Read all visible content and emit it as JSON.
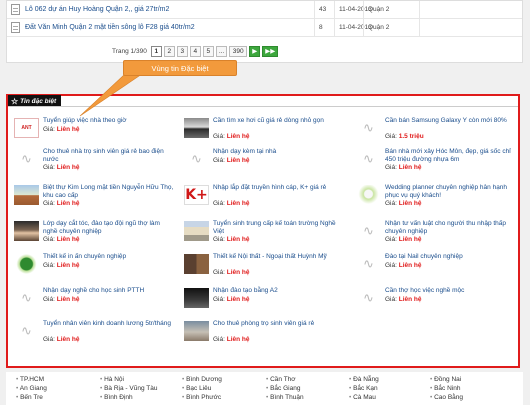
{
  "listing": {
    "rows": [
      {
        "title": "Lô 062 dự án Huy Hoàng Quận 2,, giá 27tr/m2",
        "c1": "43",
        "c2": "11-04-2013",
        "c3": "Quận 2",
        "c4": ""
      },
      {
        "title": "Đất Văn Minh Quận 2 mặt tiền sông lô F28 giá 40tr/m2",
        "c1": "8",
        "c2": "11-04-2013",
        "c3": "Quận 2",
        "c4": ""
      }
    ],
    "pager": {
      "info": "Trang 1/390",
      "pages": [
        "1",
        "2",
        "3",
        "4",
        "5",
        "...",
        "390"
      ],
      "next": "▶",
      "last": "▶▶"
    }
  },
  "callout": {
    "label": "Vùng tin Đặc biệt"
  },
  "special": {
    "tag_label": "Tin đặc biệt",
    "price_prefix": "Giá: ",
    "items": [
      {
        "title": "Tuyển giúp việc nhà theo giờ",
        "price": "Liên hệ",
        "thumb": "logo",
        "thumb_text": "ANT"
      },
      {
        "title": "Cần tìm xe hơi cũ giá rẻ dòng nhỏ gọn",
        "price": "Liên hệ",
        "thumb": "car"
      },
      {
        "title": "Cần bán Samsung Galaxy Y còn mới 80%",
        "price": "1.5 triệu",
        "thumb": "na"
      },
      {
        "title": "Cho thuê nhà trọ sinh viên giá rẻ bao điện nước",
        "price": "Liên hệ",
        "thumb": "na"
      },
      {
        "title": "Nhận dạy kèm tại nhà",
        "price": "Liên hệ",
        "thumb": "na"
      },
      {
        "title": "Bán nhà mới xây Hóc Môn, đẹp, giá sốc chỉ 450 triệu đường nhựa 6m",
        "price": "Liên hệ",
        "thumb": "na"
      },
      {
        "title": "Biệt thự Kim Long mặt tiền Nguyễn Hữu Thọ, khu cao cấp",
        "price": "Liên hệ",
        "thumb": "house"
      },
      {
        "title": "Nhập lắp đặt truyền hình cáp, K+ giá rẻ",
        "price": "Liên hệ",
        "thumb": "k",
        "thumb_text": "K+"
      },
      {
        "title": "Wedding planner chuyên nghiệp hân hạnh phục vụ quý khách!",
        "price": "Liên hệ",
        "thumb": "flower"
      },
      {
        "title": "Lớp dạy cắt tóc, đào tạo đội ngũ thợ làm nghề chuyên nghiệp",
        "price": "Liên hệ",
        "thumb": "girl"
      },
      {
        "title": "Tuyển sinh trung cấp kế toán trường Nghề Việt",
        "price": "Liên hệ",
        "thumb": "building"
      },
      {
        "title": "Nhận tư vấn luật cho người thu nhập thấp chuyên nghiệp",
        "price": "Liên hệ",
        "thumb": "na"
      },
      {
        "title": "Thiết kế in ấn chuyên nghiệp",
        "price": "Liên hệ",
        "thumb": "tree"
      },
      {
        "title": "Thiết kế Nội thất - Ngoại thất Huỳnh Mỹ",
        "price": "Liên hệ",
        "thumb": "cab"
      },
      {
        "title": "Đào tại Nail chuyên nghiệp",
        "price": "Liên hệ",
        "thumb": "na"
      },
      {
        "title": "Nhận dạy nghề cho học sinh PTTH",
        "price": "Liên hệ",
        "thumb": "na"
      },
      {
        "title": "Nhận đào tạo bằng A2",
        "price": "Liên hệ",
        "thumb": "dark"
      },
      {
        "title": "Cần thợ học việc nghề mộc",
        "price": "Liên hệ",
        "thumb": "na"
      },
      {
        "title": "Tuyển nhân viên kinh doanh lương 5tr/tháng",
        "price": "Liên hệ",
        "thumb": "na"
      },
      {
        "title": "Cho thuê phòng trọ sinh viên giá rẻ",
        "price": "Liên hệ",
        "thumb": "room"
      }
    ]
  },
  "footer": {
    "links": [
      "TP.HCM",
      "Hà Nội",
      "Bình Dương",
      "Cần Thơ",
      "Đà Nẵng",
      "Đồng Nai",
      "An Giang",
      "Bà Rịa - Vũng Tàu",
      "Bạc Liêu",
      "Bắc Giang",
      "Bắc Kạn",
      "Bắc Ninh",
      "Bến Tre",
      "Bình Định",
      "Bình Phước",
      "Bình Thuận",
      "Cà Mau",
      "Cao Bằng"
    ]
  }
}
